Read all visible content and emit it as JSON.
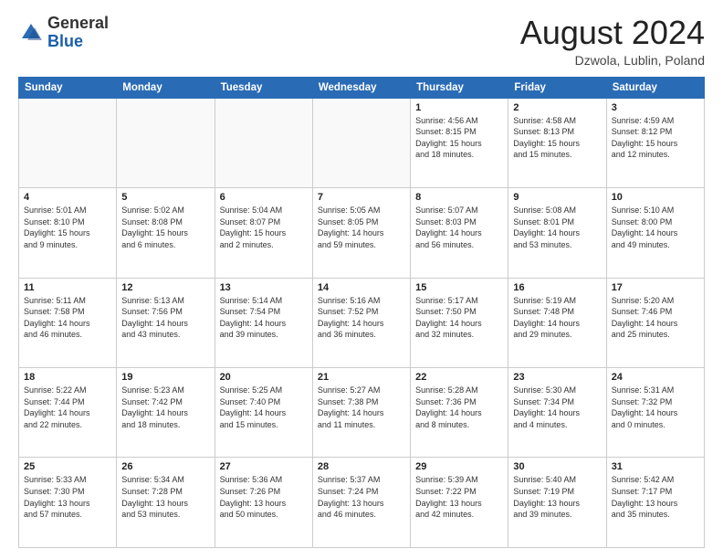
{
  "header": {
    "logo": {
      "general": "General",
      "blue": "Blue"
    },
    "title": "August 2024",
    "location": "Dzwola, Lublin, Poland"
  },
  "weekdays": [
    "Sunday",
    "Monday",
    "Tuesday",
    "Wednesday",
    "Thursday",
    "Friday",
    "Saturday"
  ],
  "weeks": [
    [
      {
        "day": "",
        "info": ""
      },
      {
        "day": "",
        "info": ""
      },
      {
        "day": "",
        "info": ""
      },
      {
        "day": "",
        "info": ""
      },
      {
        "day": "1",
        "info": "Sunrise: 4:56 AM\nSunset: 8:15 PM\nDaylight: 15 hours\nand 18 minutes."
      },
      {
        "day": "2",
        "info": "Sunrise: 4:58 AM\nSunset: 8:13 PM\nDaylight: 15 hours\nand 15 minutes."
      },
      {
        "day": "3",
        "info": "Sunrise: 4:59 AM\nSunset: 8:12 PM\nDaylight: 15 hours\nand 12 minutes."
      }
    ],
    [
      {
        "day": "4",
        "info": "Sunrise: 5:01 AM\nSunset: 8:10 PM\nDaylight: 15 hours\nand 9 minutes."
      },
      {
        "day": "5",
        "info": "Sunrise: 5:02 AM\nSunset: 8:08 PM\nDaylight: 15 hours\nand 6 minutes."
      },
      {
        "day": "6",
        "info": "Sunrise: 5:04 AM\nSunset: 8:07 PM\nDaylight: 15 hours\nand 2 minutes."
      },
      {
        "day": "7",
        "info": "Sunrise: 5:05 AM\nSunset: 8:05 PM\nDaylight: 14 hours\nand 59 minutes."
      },
      {
        "day": "8",
        "info": "Sunrise: 5:07 AM\nSunset: 8:03 PM\nDaylight: 14 hours\nand 56 minutes."
      },
      {
        "day": "9",
        "info": "Sunrise: 5:08 AM\nSunset: 8:01 PM\nDaylight: 14 hours\nand 53 minutes."
      },
      {
        "day": "10",
        "info": "Sunrise: 5:10 AM\nSunset: 8:00 PM\nDaylight: 14 hours\nand 49 minutes."
      }
    ],
    [
      {
        "day": "11",
        "info": "Sunrise: 5:11 AM\nSunset: 7:58 PM\nDaylight: 14 hours\nand 46 minutes."
      },
      {
        "day": "12",
        "info": "Sunrise: 5:13 AM\nSunset: 7:56 PM\nDaylight: 14 hours\nand 43 minutes."
      },
      {
        "day": "13",
        "info": "Sunrise: 5:14 AM\nSunset: 7:54 PM\nDaylight: 14 hours\nand 39 minutes."
      },
      {
        "day": "14",
        "info": "Sunrise: 5:16 AM\nSunset: 7:52 PM\nDaylight: 14 hours\nand 36 minutes."
      },
      {
        "day": "15",
        "info": "Sunrise: 5:17 AM\nSunset: 7:50 PM\nDaylight: 14 hours\nand 32 minutes."
      },
      {
        "day": "16",
        "info": "Sunrise: 5:19 AM\nSunset: 7:48 PM\nDaylight: 14 hours\nand 29 minutes."
      },
      {
        "day": "17",
        "info": "Sunrise: 5:20 AM\nSunset: 7:46 PM\nDaylight: 14 hours\nand 25 minutes."
      }
    ],
    [
      {
        "day": "18",
        "info": "Sunrise: 5:22 AM\nSunset: 7:44 PM\nDaylight: 14 hours\nand 22 minutes."
      },
      {
        "day": "19",
        "info": "Sunrise: 5:23 AM\nSunset: 7:42 PM\nDaylight: 14 hours\nand 18 minutes."
      },
      {
        "day": "20",
        "info": "Sunrise: 5:25 AM\nSunset: 7:40 PM\nDaylight: 14 hours\nand 15 minutes."
      },
      {
        "day": "21",
        "info": "Sunrise: 5:27 AM\nSunset: 7:38 PM\nDaylight: 14 hours\nand 11 minutes."
      },
      {
        "day": "22",
        "info": "Sunrise: 5:28 AM\nSunset: 7:36 PM\nDaylight: 14 hours\nand 8 minutes."
      },
      {
        "day": "23",
        "info": "Sunrise: 5:30 AM\nSunset: 7:34 PM\nDaylight: 14 hours\nand 4 minutes."
      },
      {
        "day": "24",
        "info": "Sunrise: 5:31 AM\nSunset: 7:32 PM\nDaylight: 14 hours\nand 0 minutes."
      }
    ],
    [
      {
        "day": "25",
        "info": "Sunrise: 5:33 AM\nSunset: 7:30 PM\nDaylight: 13 hours\nand 57 minutes."
      },
      {
        "day": "26",
        "info": "Sunrise: 5:34 AM\nSunset: 7:28 PM\nDaylight: 13 hours\nand 53 minutes."
      },
      {
        "day": "27",
        "info": "Sunrise: 5:36 AM\nSunset: 7:26 PM\nDaylight: 13 hours\nand 50 minutes."
      },
      {
        "day": "28",
        "info": "Sunrise: 5:37 AM\nSunset: 7:24 PM\nDaylight: 13 hours\nand 46 minutes."
      },
      {
        "day": "29",
        "info": "Sunrise: 5:39 AM\nSunset: 7:22 PM\nDaylight: 13 hours\nand 42 minutes."
      },
      {
        "day": "30",
        "info": "Sunrise: 5:40 AM\nSunset: 7:19 PM\nDaylight: 13 hours\nand 39 minutes."
      },
      {
        "day": "31",
        "info": "Sunrise: 5:42 AM\nSunset: 7:17 PM\nDaylight: 13 hours\nand 35 minutes."
      }
    ]
  ]
}
